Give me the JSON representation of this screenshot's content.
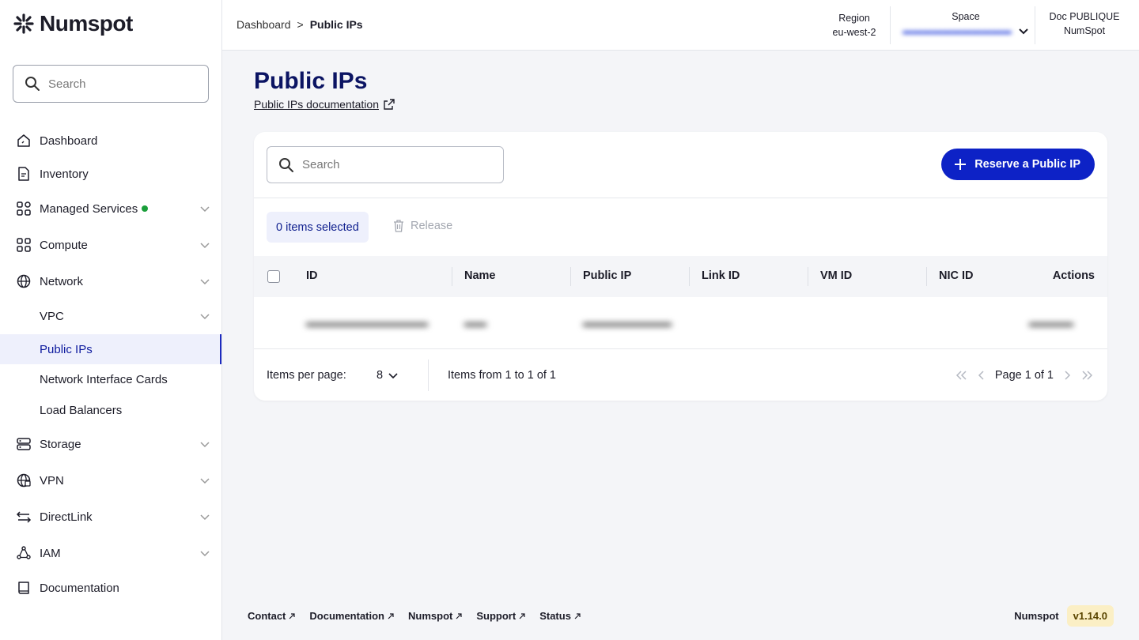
{
  "brand": {
    "name": "Numspot"
  },
  "sidebar": {
    "search_placeholder": "Search",
    "items": [
      {
        "label": "Dashboard"
      },
      {
        "label": "Inventory"
      },
      {
        "label": "Managed Services"
      },
      {
        "label": "Compute"
      },
      {
        "label": "Network"
      },
      {
        "label": "VPC"
      },
      {
        "label": "Public IPs"
      },
      {
        "label": "Network Interface Cards"
      },
      {
        "label": "Load Balancers"
      },
      {
        "label": "Storage"
      },
      {
        "label": "VPN"
      },
      {
        "label": "DirectLink"
      },
      {
        "label": "IAM"
      },
      {
        "label": "Documentation"
      }
    ]
  },
  "header": {
    "breadcrumb": [
      "Dashboard",
      ">",
      "Public IPs"
    ],
    "region_label": "Region",
    "region_value": "eu-west-2",
    "space_label": "Space",
    "org_label": "Doc PUBLIQUE",
    "org_value": "NumSpot"
  },
  "page": {
    "title": "Public IPs",
    "doc_link": "Public IPs documentation"
  },
  "table": {
    "search_placeholder": "Search",
    "reserve_button": "Reserve a Public IP",
    "selected_label": "0 items selected",
    "release_label": "Release",
    "columns": [
      "ID",
      "Name",
      "Public IP",
      "Link ID",
      "VM ID",
      "NIC ID",
      "Actions"
    ],
    "items_per_page_label": "Items per page:",
    "items_per_page_value": "8",
    "range_label": "Items from 1 to 1 of 1",
    "page_label": "Page 1 of 1"
  },
  "footer": {
    "links": [
      "Contact",
      "Documentation",
      "Numspot",
      "Support",
      "Status"
    ],
    "brand": "Numspot",
    "version": "v1.14.0"
  },
  "colors": {
    "accent": "#0d22c6",
    "title": "#0b1463",
    "status_dot": "#1a9e3a"
  }
}
